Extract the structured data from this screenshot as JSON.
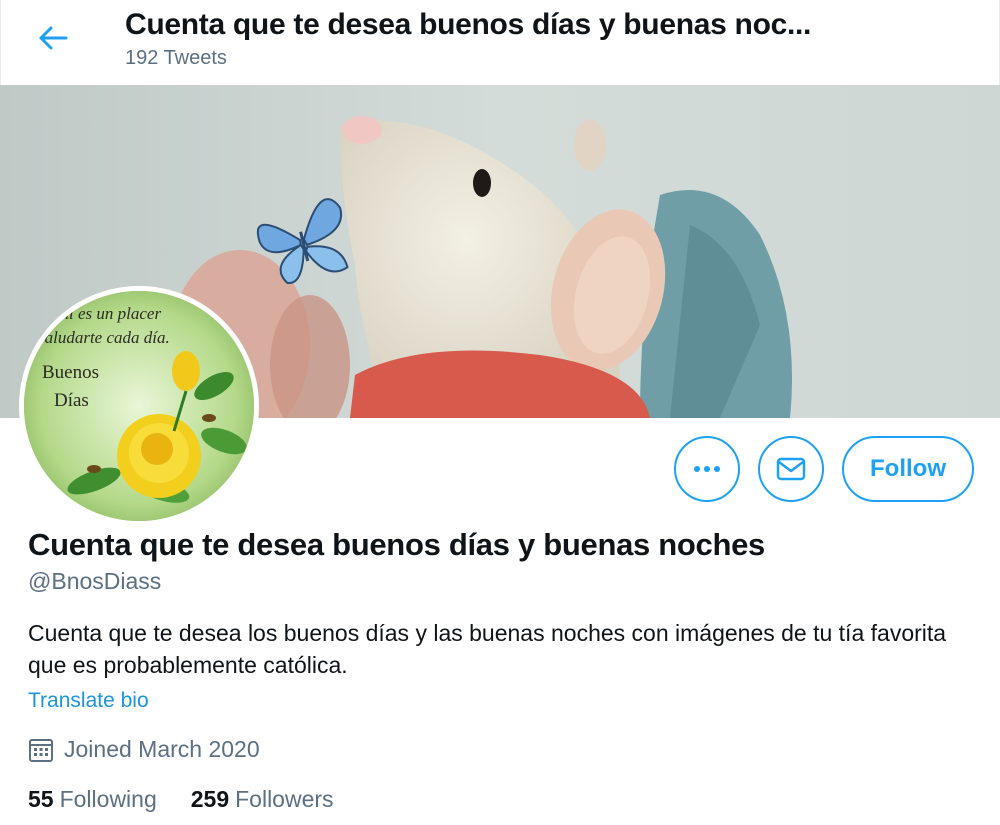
{
  "header": {
    "title": "Cuenta que te desea buenos días y buenas noc...",
    "tweet_count": "192 Tweets"
  },
  "banner": {
    "description": "rat-plush-with-butterfly"
  },
  "avatar": {
    "text_line1": "a mí es un placer",
    "text_line2": "saludarte cada día.",
    "text_line3": "Buenos",
    "text_line4": "Días"
  },
  "actions": {
    "more_icon": "more-icon",
    "message_icon": "envelope-icon",
    "follow_label": "Follow"
  },
  "profile": {
    "name": "Cuenta que te desea buenos días y buenas noches",
    "handle": "@BnosDiass",
    "bio": "Cuenta que te desea los buenos días y las buenas noches con imágenes de tu tía favorita que es probablemente católica.",
    "translate_label": "Translate bio",
    "joined": "Joined March 2020",
    "following_count": "55",
    "following_label": "Following",
    "followers_count": "259",
    "followers_label": "Followers"
  },
  "colors": {
    "accent": "#1da1f2",
    "secondary_text": "#5b7083",
    "link": "#1b95e0"
  }
}
